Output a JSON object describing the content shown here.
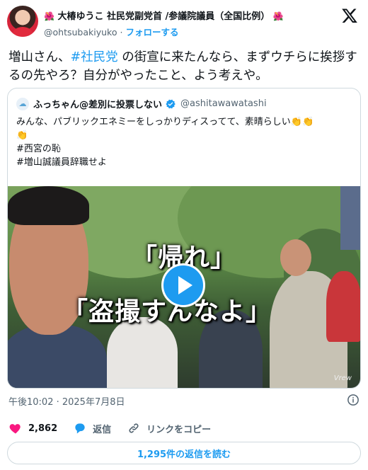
{
  "author": {
    "flower_left": "🌺",
    "name": "大椿ゆうこ 社民党副党首 /参議院議員（全国比例）",
    "flower_right": "🌺",
    "handle": "@ohtsubakiyuko",
    "separator": "·",
    "follow_label": "フォローする"
  },
  "tweet": {
    "text_before": "増山さん、",
    "hashtag": "#社民党",
    "text_after": " の街宣に来たんなら、まずウチらに挨拶するの先やろ？自分がやったこと、よう考えや。"
  },
  "quote": {
    "name": "ふっちゃん@差別に投票しない",
    "handle": "@ashitawawatashi",
    "line1": "みんな、パブリックエネミーをしっかりディスってて、素晴らしい",
    "clap_inline": "👏👏",
    "clap_line": "👏",
    "tag1": "#西宮の恥",
    "tag2": "#増山誠議員辞職せよ",
    "video": {
      "caption1": "「帰れ」",
      "caption2": "「盗撮すんなよ」",
      "watermark": "Vrew"
    }
  },
  "timestamp": "午後10:02 · 2025年7月8日",
  "actions": {
    "likes": "2,862",
    "reply_label": "返信",
    "copy_link_label": "リンクをコピー"
  },
  "read_replies_label": "1,295件の返信を読む",
  "colors": {
    "accent": "#1d9bf0",
    "like": "#f91880",
    "text": "#0f1419",
    "muted": "#536471",
    "border": "#cfd9de"
  }
}
